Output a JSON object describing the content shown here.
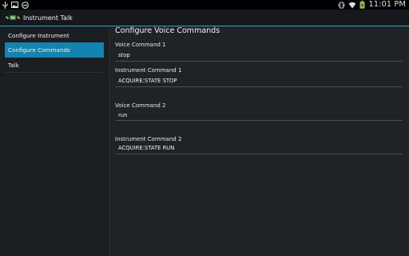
{
  "status_bar": {
    "time": "11:01 PM",
    "left_icons": [
      "usb-icon",
      "image-icon",
      "dnd-icon"
    ],
    "right_icons": [
      "vibrate-icon",
      "wifi-icon",
      "battery-icon"
    ]
  },
  "action_bar": {
    "title": "Instrument Talk",
    "icon": "instrument-icon"
  },
  "sidebar": {
    "items": [
      {
        "label": "Configure Instrument",
        "selected": false
      },
      {
        "label": "Configure Commands",
        "selected": true
      },
      {
        "label": "Talk",
        "selected": false
      }
    ]
  },
  "main": {
    "title": "Configure Voice Commands",
    "fields": [
      {
        "label": "Voice Command 1",
        "value": "stop"
      },
      {
        "label": "Instrument Command 1",
        "value": "ACQUIRE:STATE STOP"
      },
      {
        "label": "Voice Command 2",
        "value": "run"
      },
      {
        "label": "Instrument Command 2",
        "value": "ACQUIRE:STATE RUN"
      }
    ]
  },
  "colors": {
    "accent": "#1384b0",
    "background": "#202326",
    "sidebar": "#1c1f22",
    "statusbar": "#000000"
  }
}
